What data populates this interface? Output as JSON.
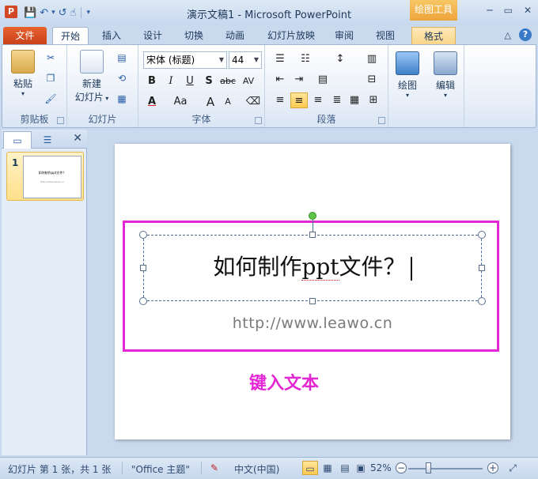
{
  "window": {
    "title": "演示文稿1 - Microsoft PowerPoint",
    "context_tool": "绘图工具",
    "minimize": "─",
    "restore": "▭",
    "close": "✕"
  },
  "qat": {
    "save": "💾",
    "undo": "↶",
    "undo_drop": "▾",
    "redo": "↺",
    "touch": "☝",
    "customize": "▾"
  },
  "tabs": {
    "file": "文件",
    "items": [
      "开始",
      "插入",
      "设计",
      "切换",
      "动画",
      "幻灯片放映",
      "审阅",
      "视图",
      "格式"
    ],
    "active": "开始",
    "minimize_ribbon": "△",
    "help": "?"
  },
  "ribbon": {
    "clipboard": {
      "label": "剪贴板",
      "paste": "粘贴"
    },
    "slides": {
      "label": "幻灯片",
      "new_slide_line1": "新建",
      "new_slide_line2": "幻灯片"
    },
    "font": {
      "label": "字体",
      "font_name": "宋体 (标题)",
      "font_size": "44",
      "bold": "B",
      "italic": "I",
      "underline": "U",
      "shadow": "S",
      "strike": "abc",
      "spacing": "AV",
      "color": "A",
      "case": "Aa",
      "grow": "A",
      "shrink": "A"
    },
    "paragraph": {
      "label": "段落"
    },
    "drawing": {
      "label": "绘图",
      "button": "绘图"
    },
    "editing": {
      "label": "编辑",
      "button": "编辑"
    }
  },
  "pane": {
    "close": "✕",
    "slide_number": "1",
    "thumb_title": "如何制作ppt文件？",
    "thumb_sub": "http://www.leawo.cn"
  },
  "slide": {
    "title_prefix": "如何制作",
    "title_squiggle": "ppt",
    "title_suffix": "文件？",
    "url": "http://www.leawo.cn",
    "annotation": "键入文本"
  },
  "status": {
    "slide_info": "幻灯片 第 1 张，共 1 张",
    "theme": "\"Office 主题\"",
    "language": "中文(中国)",
    "zoom": "52%",
    "zoom_minus": "−",
    "zoom_plus": "+"
  },
  "colors": {
    "accent": "#e427d4",
    "file_tab": "#d24726",
    "rotation_handle": "#5ec548"
  }
}
